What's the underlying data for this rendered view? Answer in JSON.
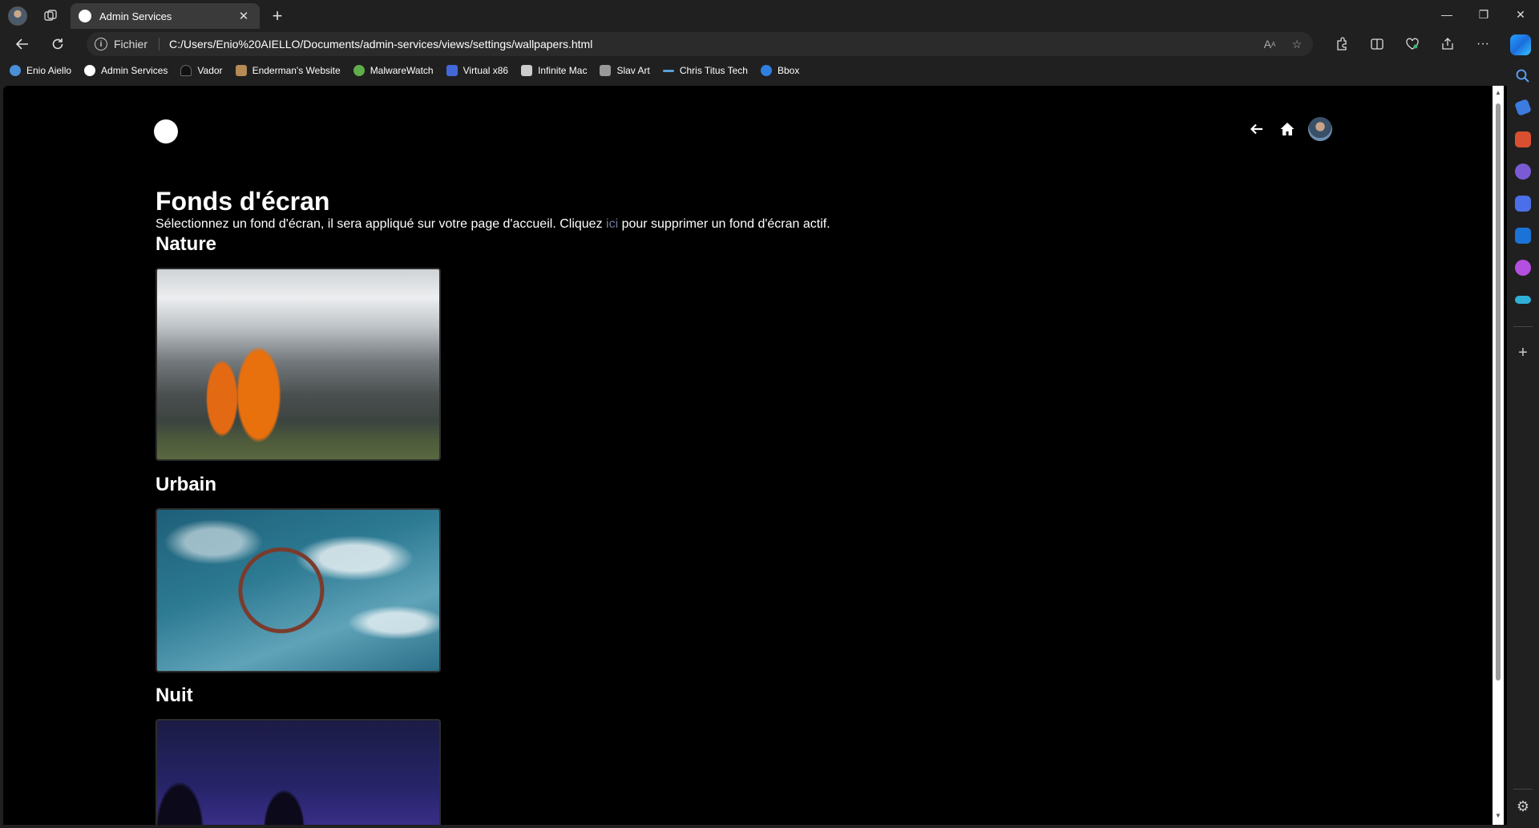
{
  "browser": {
    "tab_title": "Admin Services",
    "url_scheme_label": "Fichier",
    "url": "C:/Users/Enio%20AIELLO/Documents/admin-services/views/settings/wallpapers.html"
  },
  "bookmarks": [
    {
      "label": "Enio Aiello",
      "icon": "globe-icon",
      "color": "#4a8fd8"
    },
    {
      "label": "Admin Services",
      "icon": "circle-icon",
      "color": "#ffffff"
    },
    {
      "label": "Vador",
      "icon": "helmet-icon",
      "color": "#111111"
    },
    {
      "label": "Enderman's Website",
      "icon": "lock-icon",
      "color": "#b58a55"
    },
    {
      "label": "MalwareWatch",
      "icon": "shield-icon",
      "color": "#5fae4a"
    },
    {
      "label": "Virtual x86",
      "icon": "chip-icon",
      "color": "#4468d8"
    },
    {
      "label": "Infinite Mac",
      "icon": "mac-icon",
      "color": "#cccccc"
    },
    {
      "label": "Slav Art",
      "icon": "brush-icon",
      "color": "#999999"
    },
    {
      "label": "Chris Titus Tech",
      "icon": "dash-icon",
      "color": "#5aa0d8"
    },
    {
      "label": "Bbox",
      "icon": "cube-icon",
      "color": "#2f7fe0"
    }
  ],
  "page": {
    "title": "Fonds d'écran",
    "description_before": "Sélectionnez un fond d'écran, il sera appliqué sur votre page d'accueil. Cliquez ",
    "description_link": "ici",
    "description_after": " pour supprimer un fond d'écran actif."
  },
  "sections": [
    {
      "title": "Nature"
    },
    {
      "title": "Urbain"
    },
    {
      "title": "Nuit"
    }
  ],
  "colors": {
    "page_bg": "#000000",
    "link": "#6e7a99",
    "chrome_bg": "#202020"
  }
}
